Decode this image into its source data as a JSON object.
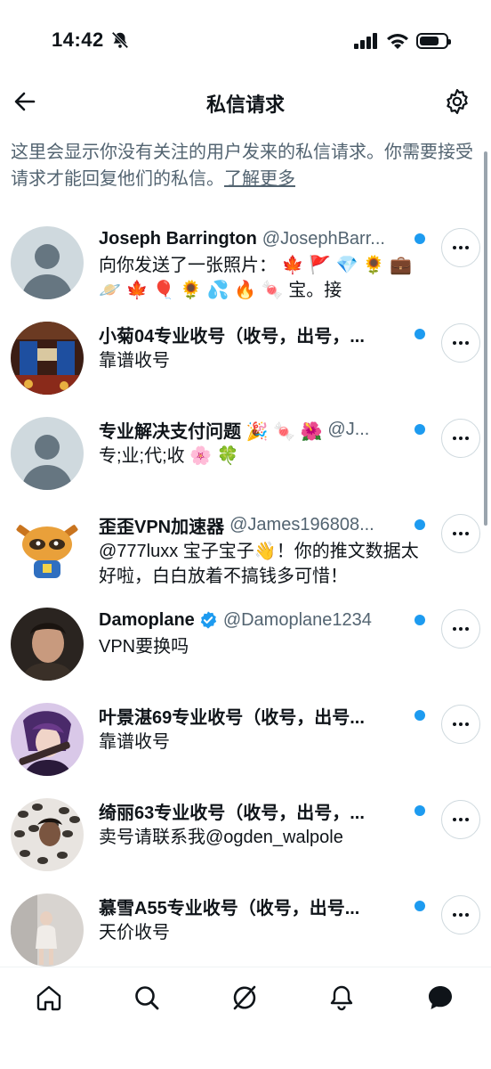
{
  "status_bar": {
    "time": "14:42",
    "battery_level": 0.75
  },
  "header": {
    "title": "私信请求",
    "back_icon": "arrow-left-icon",
    "settings_icon": "gear-icon"
  },
  "info": {
    "text": "这里会显示你没有关注的用户发来的私信请求。你需要接受请求才能回复他们的私信。",
    "link": "了解更多"
  },
  "requests": [
    {
      "name": "Joseph Barrington",
      "handle": "@JosephBarr...",
      "verified": false,
      "message": "向你发送了一张照片： 🍁 🚩 💎 🌻 💼 🪐 🍁 🎈 🌻 💦 🔥 🍬 宝。接",
      "avatar": "default",
      "unread": true
    },
    {
      "name": "小菊04专业收号（收号，出号，...",
      "handle": "",
      "verified": false,
      "message": "靠谱收号",
      "avatar": "game",
      "unread": true
    },
    {
      "name": "专业解决支付问题 🎉 🍬 🌺",
      "handle": "@J...",
      "verified": false,
      "message": "专;业;代;收 🌸 🍀",
      "avatar": "default",
      "unread": true
    },
    {
      "name": "歪歪VPN加速器",
      "handle": "@James196808...",
      "verified": false,
      "message": "@777luxx 宝子宝子👋！你的推文数据太好啦，白白放着不搞钱多可惜！",
      "avatar": "raccoon",
      "unread": true
    },
    {
      "name": "Damoplane",
      "handle": "@Damoplane1234",
      "verified": true,
      "message": "VPN要换吗",
      "avatar": "portrait",
      "unread": true
    },
    {
      "name": "叶景湛69专业收号（收号，出号...",
      "handle": "",
      "verified": false,
      "message": "靠谱收号",
      "avatar": "anime",
      "unread": true
    },
    {
      "name": "绮丽63专业收号（收号，出号，...",
      "handle": "",
      "verified": false,
      "message": "卖号请联系我@ogden_walpole",
      "avatar": "leopard",
      "unread": true
    },
    {
      "name": "慕雪A55专业收号（收号，出号...",
      "handle": "",
      "verified": false,
      "message": "天价收号",
      "avatar": "photo",
      "unread": true
    }
  ],
  "more_icon": "more-horizontal-icon",
  "bottom_nav": [
    {
      "icon": "home-icon"
    },
    {
      "icon": "search-icon"
    },
    {
      "icon": "grok-icon"
    },
    {
      "icon": "bell-icon"
    },
    {
      "icon": "message-icon"
    }
  ],
  "colors": {
    "accent": "#1d9bf0",
    "text": "#0f1419",
    "secondary": "#536471"
  }
}
